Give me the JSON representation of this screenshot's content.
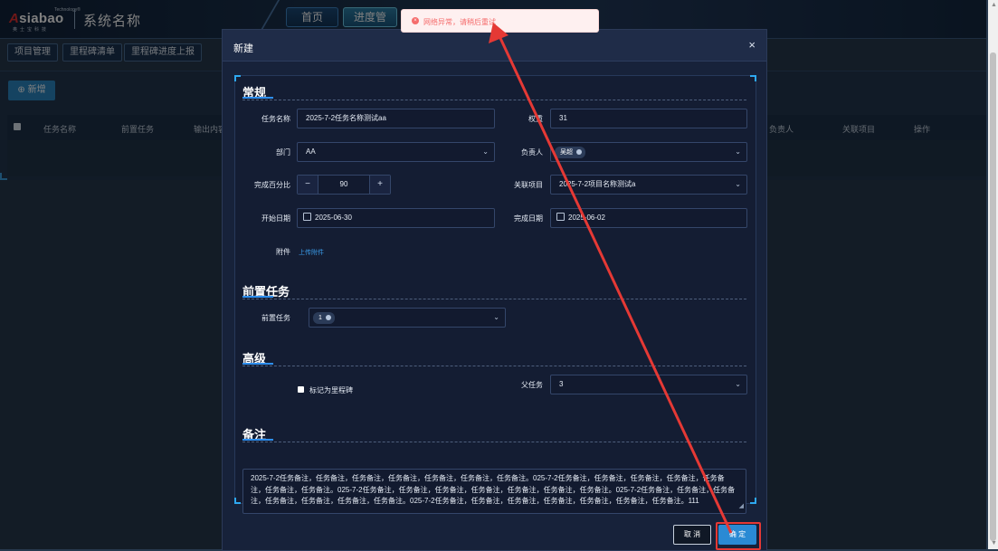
{
  "app": {
    "logo_text": "Asiabao",
    "logo_sup": "Technology®",
    "logo_sub": "奥士宝科技",
    "system_name": "系统名称"
  },
  "top_nav": {
    "home": "首页",
    "progress": "进度管理"
  },
  "sub_nav": {
    "items": [
      "项目管理",
      "里程碑清单",
      "里程碑进度上报"
    ]
  },
  "list": {
    "add_button": "⊕ 新增",
    "columns": [
      "任务名称",
      "前置任务",
      "输出内容",
      "负责人",
      "关联项目",
      "操作"
    ]
  },
  "toast": {
    "icon": "error-icon",
    "message": "网络异常，请稍后重试",
    "color": "#f56c6c"
  },
  "modal": {
    "title": "新建",
    "close": "×",
    "sections": {
      "general": "常规",
      "predecessor": "前置任务",
      "advanced": "高级",
      "remark": "备注"
    },
    "fields": {
      "task_name_label": "任务名称",
      "task_name_value": "2025-7-2任务名称测试aa",
      "weight_label": "权重",
      "weight_value": "31",
      "department_label": "部门",
      "department_value": "AA",
      "owner_label": "负责人",
      "owner_tag": "吴超",
      "percent_label": "完成百分比",
      "percent_minus": "−",
      "percent_value": "90",
      "percent_plus": "+",
      "project_label": "关联项目",
      "project_value": "2025-7-2项目名称测试a",
      "start_label": "开始日期",
      "start_value": "2025-06-30",
      "end_label": "完成日期",
      "end_value": "2025-06-02",
      "attachment_label": "附件",
      "upload_link": "上传附件",
      "pre_task_label": "前置任务",
      "pre_task_tag": "1",
      "milestone_checkbox_label": "标记为里程碑",
      "parent_label": "父任务",
      "parent_value": "3",
      "remark_text": "2025-7-2任务备注，任务备注，任务备注，任务备注，任务备注，任务备注，任务备注。025-7-2任务备注，任务备注，任务备注，任务备注，任务备注，任务备注，任务备注。025-7-2任务备注，任务备注，任务备注，任务备注，任务备注，任务备注，任务备注。025-7-2任务备注，任务备注，任务备注，任务备注，任务备注，任务备注，任务备注。025-7-2任务备注，任务备注，任务备注，任务备注，任务备注，任务备注，任务备注。111"
    },
    "buttons": {
      "cancel": "取 消",
      "ok": "确 定"
    }
  },
  "annotation": {
    "color": "#e53935"
  }
}
